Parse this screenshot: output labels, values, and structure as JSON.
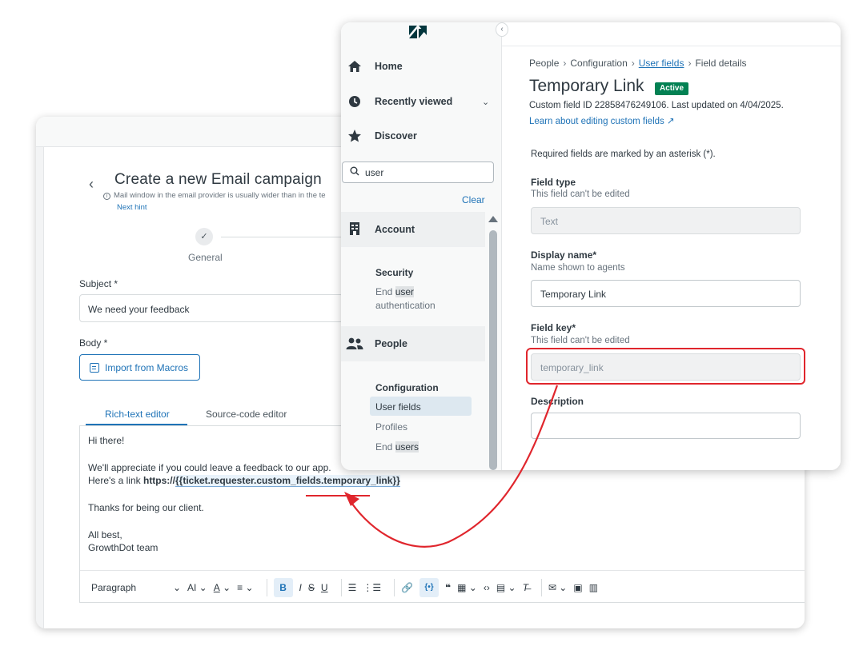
{
  "campaign": {
    "title": "Create a new Email campaign",
    "hint": "Mail window in the email provider is usually wider than in the te",
    "next_hint": "Next hint",
    "step_check": "✓",
    "step_label": "General",
    "subject_label": "Subject *",
    "subject_value": "We need your feedback",
    "body_label": "Body *",
    "import_button": "Import from Macros",
    "tabs": [
      "Rich-text editor",
      "Source-code editor"
    ],
    "body_lines": [
      "Hi there!",
      "We'll appreciate if you could leave a feedback to our app.",
      "Here's a link ",
      "https://",
      "{{ticket.requester.custom_fields.temporary_link}}",
      "Thanks for being our client.",
      "All best,",
      "GrowthDot team"
    ],
    "toolbar": {
      "paragraph": "Paragraph",
      "font_size": "AI",
      "font_color": "A",
      "bold": "B",
      "italic": "I",
      "strike": "S",
      "underline": "U",
      "placeholder": "{•}"
    }
  },
  "admin": {
    "nav": {
      "home": "Home",
      "recently_viewed": "Recently viewed",
      "discover": "Discover",
      "search_value": "user",
      "clear": "Clear",
      "results": {
        "account": "Account",
        "security": "Security",
        "end_label": "End ",
        "user_hl": "user",
        "authentication": "authentication",
        "people": "People",
        "configuration": "Configuration",
        "user_fields_hl": "User",
        "user_fields_rest": " fields",
        "profiles": "Profiles",
        "end_users_end": "End ",
        "end_users_hl": "users"
      }
    },
    "breadcrumb": {
      "people": "People",
      "configuration": "Configuration",
      "user_fields": "User fields",
      "field_details": "Field details"
    },
    "field": {
      "title": "Temporary Link",
      "status": "Active",
      "meta": "Custom field ID 22858476249106. Last updated on 4/04/2025.",
      "learn": "Learn about editing custom fields ↗",
      "required_note": "Required fields are marked by an asterisk (*).",
      "type_label": "Field type",
      "type_hint": "This field can't be edited",
      "type_value": "Text",
      "display_label": "Display name*",
      "display_hint": "Name shown to agents",
      "display_value": "Temporary Link",
      "key_label": "Field key*",
      "key_hint": "This field can't be edited",
      "key_value": "temporary_link",
      "description_label": "Description",
      "description_value": ""
    }
  },
  "colors": {
    "accent": "#1f73b7",
    "active_badge": "#038153",
    "annotation": "#e0262d"
  }
}
